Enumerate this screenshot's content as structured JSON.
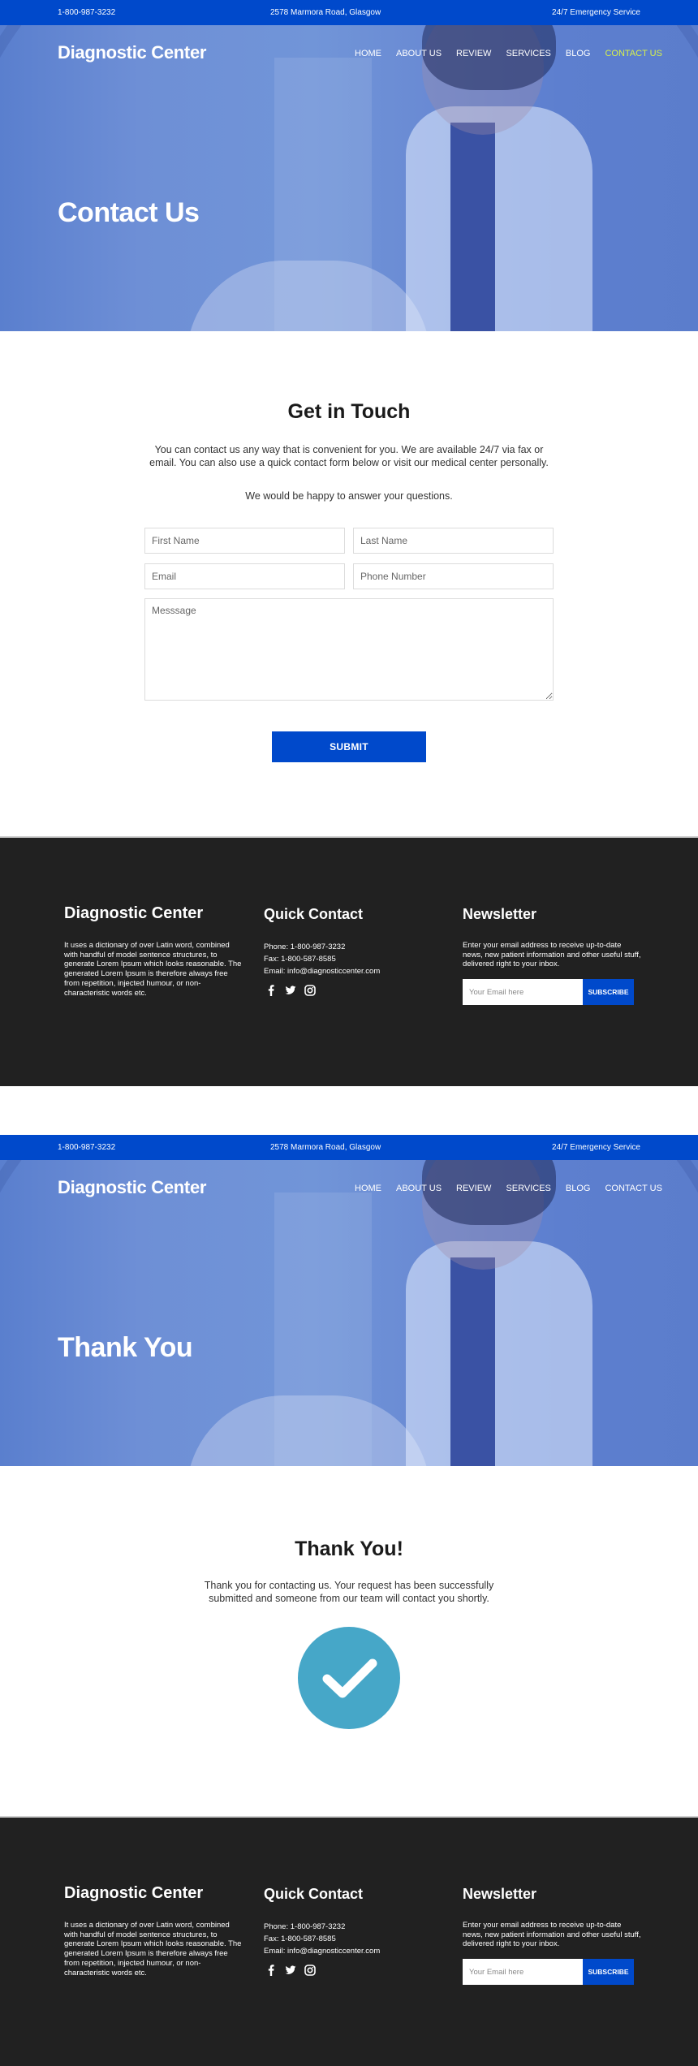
{
  "colors": {
    "brand_blue": "#0049cb",
    "nav_active": "#d7f04b",
    "footer_bg": "#212121",
    "success_circle": "#46a7c8"
  },
  "topbar": {
    "phone": "1-800-987-3232",
    "address": "2578 Marmora Road, Glasgow",
    "service": "24/7 Emergency Service"
  },
  "nav": {
    "brand": "Diagnostic Center",
    "items": [
      {
        "label": "HOME"
      },
      {
        "label": "ABOUT US"
      },
      {
        "label": "REVIEW"
      },
      {
        "label": "SERVICES"
      },
      {
        "label": "BLOG"
      },
      {
        "label": "CONTACT US"
      }
    ]
  },
  "contact_page": {
    "hero_title": "Contact Us",
    "active_nav": "CONTACT US",
    "heading": "Get in Touch",
    "intro": "You can contact us any way that is convenient for you. We are available 24/7 via fax or email. You can also use a quick contact form below or visit our medical center personally.",
    "intro2": "We would be happy to answer your questions.",
    "form": {
      "first_name_placeholder": "First Name",
      "last_name_placeholder": "Last Name",
      "email_placeholder": "Email",
      "phone_placeholder": "Phone Number",
      "message_placeholder": "Messsage",
      "submit_label": "SUBMIT"
    }
  },
  "thank_you_page": {
    "hero_title": "Thank You",
    "heading": "Thank You!",
    "message": "Thank you for contacting us. Your request has been successfully submitted and someone from our team will contact you shortly.",
    "icon": "check-circle-icon"
  },
  "footer": {
    "brand": "Diagnostic Center",
    "about": "It uses a dictionary of over Latin word, combined with handful of model sentence structures, to generate Lorem Ipsum which looks reasonable. The generated Lorem Ipsum is therefore always free from repetition, injected humour, or non- characteristic words etc.",
    "quick_contact_title": "Quick Contact",
    "phone": "Phone: 1-800-987-3232",
    "fax": "Fax: 1-800-587-8585",
    "email": "Email: info@diagnosticcenter.com",
    "social": [
      "facebook-icon",
      "twitter-icon",
      "instagram-icon"
    ],
    "newsletter_title": "Newsletter",
    "newsletter_text": "Enter your email address to receive up-to-date news, new patient information and other useful stuff, delivered right to your inbox.",
    "newsletter_placeholder": "Your Email here",
    "subscribe_label": "SUBSCRIBE"
  }
}
